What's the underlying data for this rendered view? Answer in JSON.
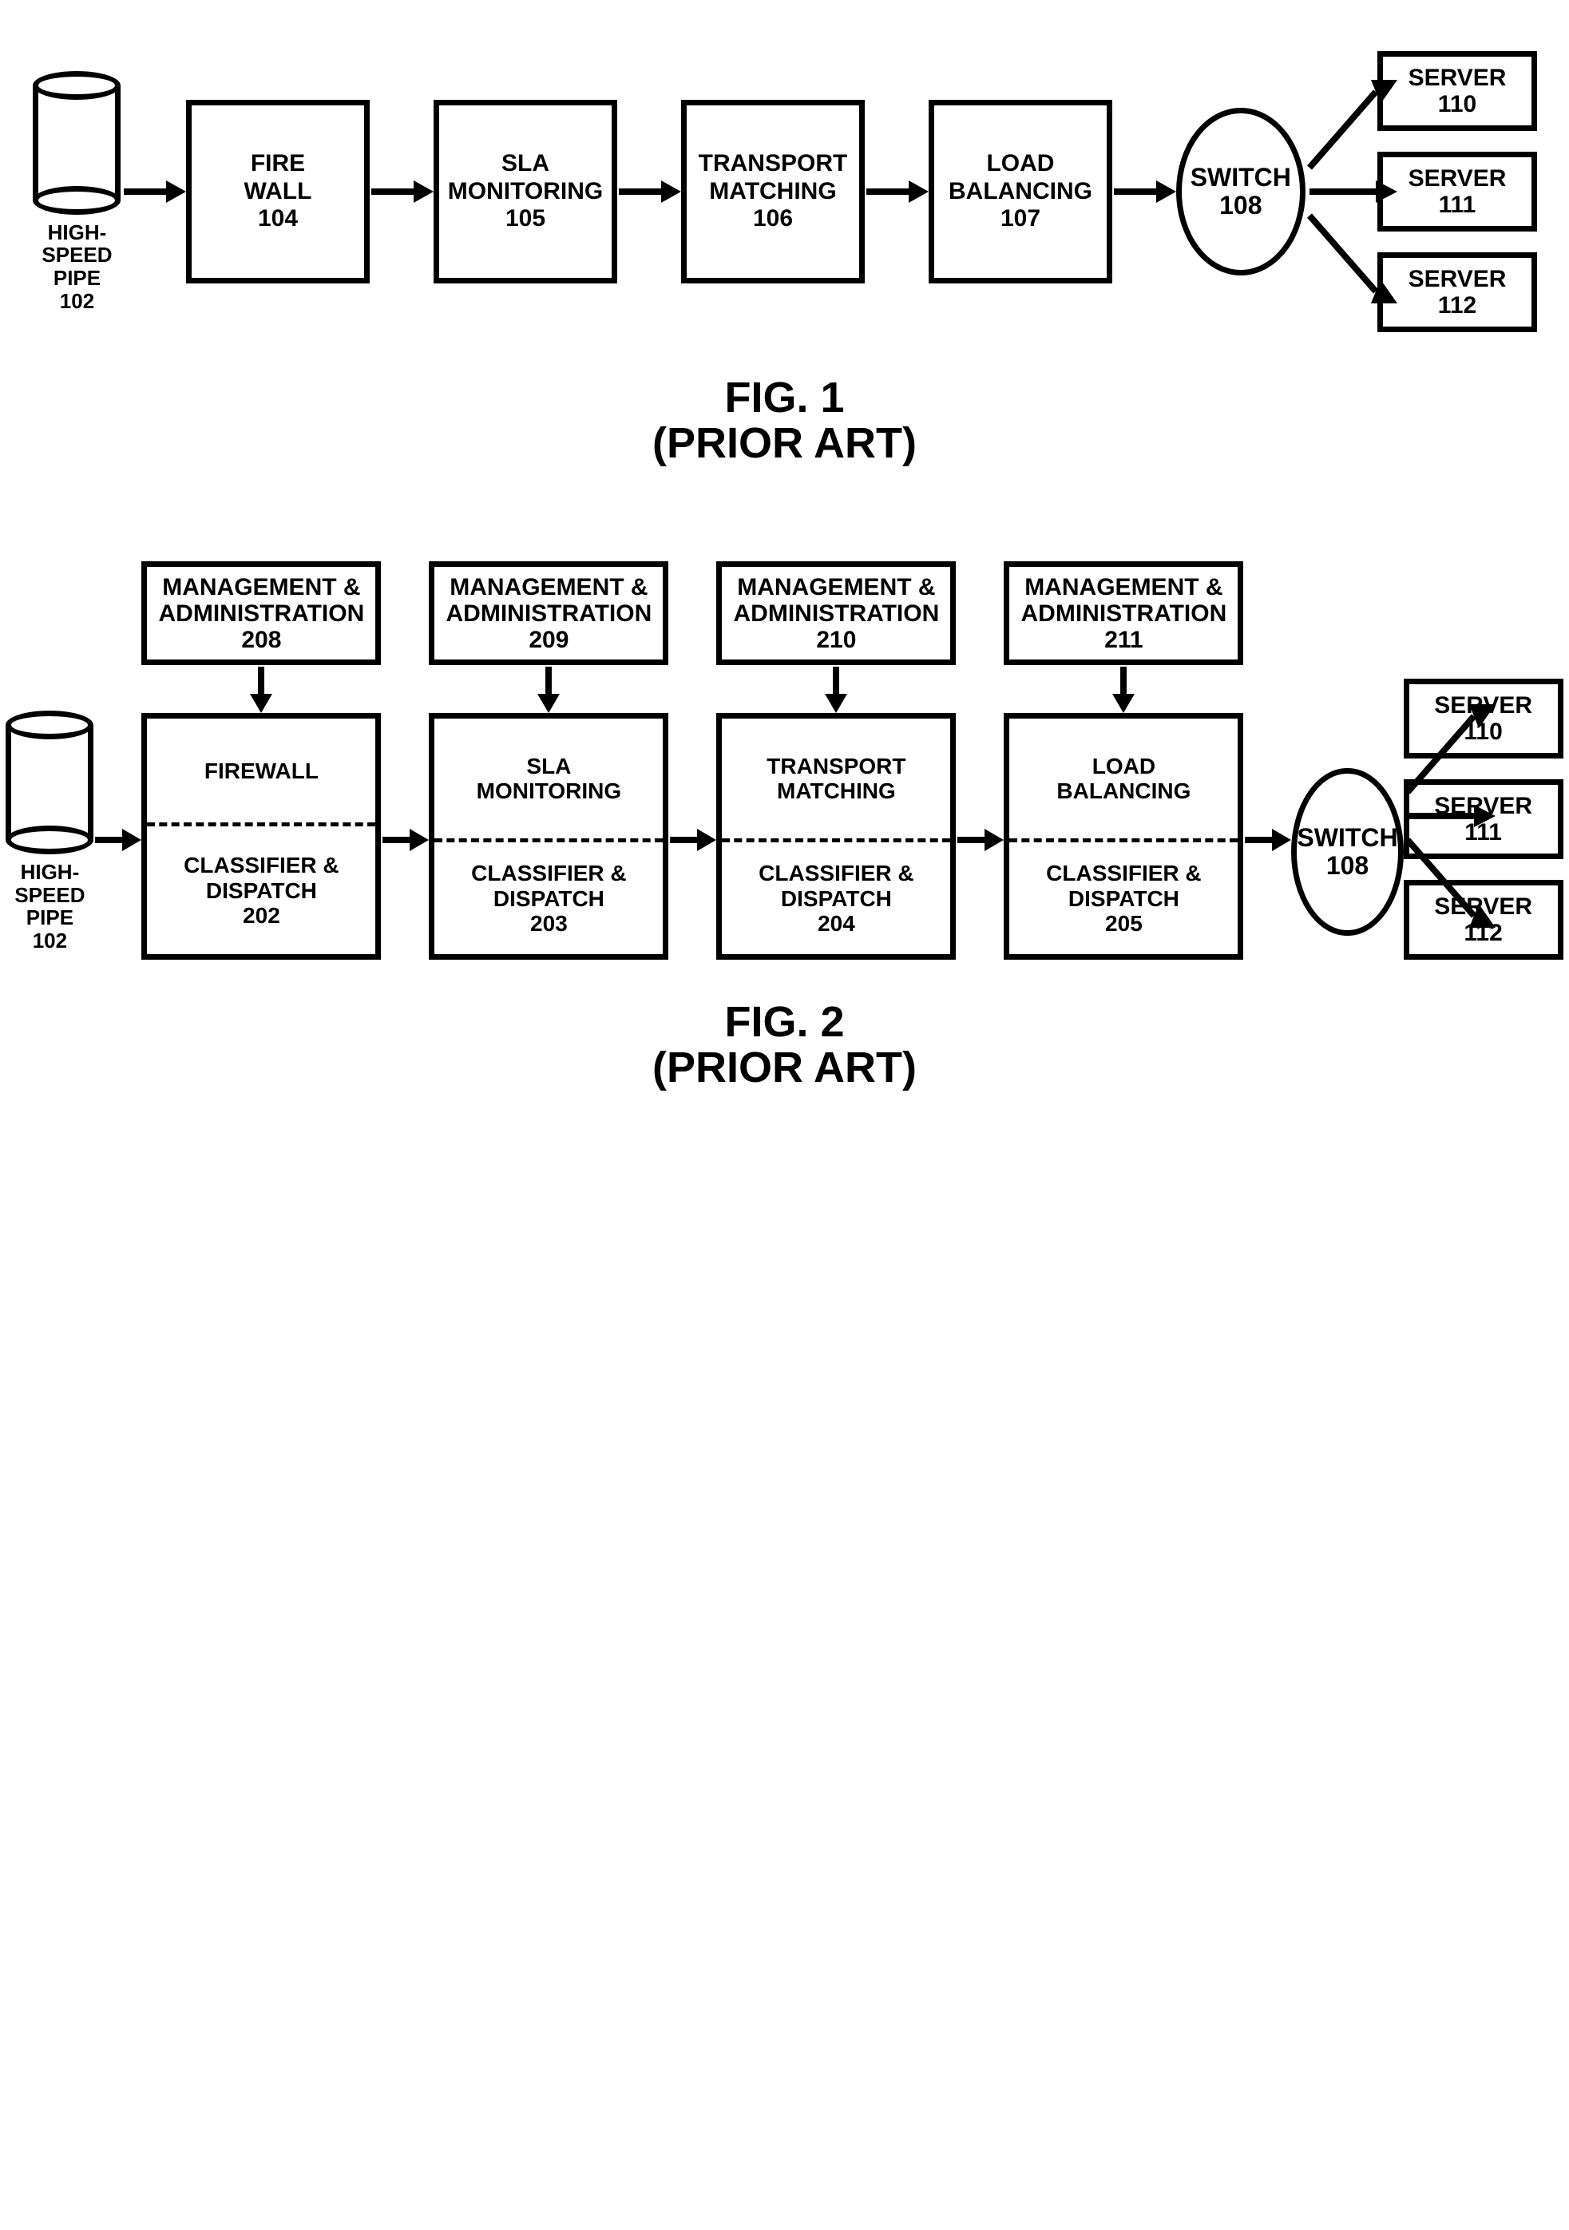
{
  "fig1": {
    "caption_line1": "FIG. 1",
    "caption_line2": "(PRIOR ART)",
    "pipe": {
      "label_l1": "HIGH-SPEED",
      "label_l2": "PIPE",
      "id": "102"
    },
    "boxes": [
      {
        "l1": "FIRE",
        "l2": "WALL",
        "id": "104"
      },
      {
        "l1": "SLA",
        "l2": "MONITORING",
        "id": "105"
      },
      {
        "l1": "TRANSPORT",
        "l2": "MATCHING",
        "id": "106"
      },
      {
        "l1": "LOAD",
        "l2": "BALANCING",
        "id": "107"
      }
    ],
    "switch": {
      "label": "SWITCH",
      "id": "108"
    },
    "servers": [
      {
        "label": "SERVER",
        "id": "110"
      },
      {
        "label": "SERVER",
        "id": "111"
      },
      {
        "label": "SERVER",
        "id": "112"
      }
    ]
  },
  "fig2": {
    "caption_line1": "FIG. 2",
    "caption_line2": "(PRIOR ART)",
    "pipe": {
      "label_l1": "HIGH-SPEED",
      "label_l2": "PIPE",
      "id": "102"
    },
    "units": [
      {
        "mgmt_l1": "MANAGEMENT &",
        "mgmt_l2": "ADMINISTRATION",
        "mgmt_id": "208",
        "top": "FIREWALL",
        "cd_l1": "CLASSIFIER &",
        "cd_l2": "DISPATCH",
        "cd_id": "202"
      },
      {
        "mgmt_l1": "MANAGEMENT &",
        "mgmt_l2": "ADMINISTRATION",
        "mgmt_id": "209",
        "top_l1": "SLA",
        "top_l2": "MONITORING",
        "cd_l1": "CLASSIFIER &",
        "cd_l2": "DISPATCH",
        "cd_id": "203"
      },
      {
        "mgmt_l1": "MANAGEMENT &",
        "mgmt_l2": "ADMINISTRATION",
        "mgmt_id": "210",
        "top_l1": "TRANSPORT",
        "top_l2": "MATCHING",
        "cd_l1": "CLASSIFIER &",
        "cd_l2": "DISPATCH",
        "cd_id": "204"
      },
      {
        "mgmt_l1": "MANAGEMENT &",
        "mgmt_l2": "ADMINISTRATION",
        "mgmt_id": "211",
        "top_l1": "LOAD",
        "top_l2": "BALANCING",
        "cd_l1": "CLASSIFIER &",
        "cd_l2": "DISPATCH",
        "cd_id": "205"
      }
    ],
    "switch": {
      "label": "SWITCH",
      "id": "108"
    },
    "servers": [
      {
        "label": "SERVER",
        "id": "110"
      },
      {
        "label": "SERVER",
        "id": "111"
      },
      {
        "label": "SERVER",
        "id": "112"
      }
    ]
  }
}
